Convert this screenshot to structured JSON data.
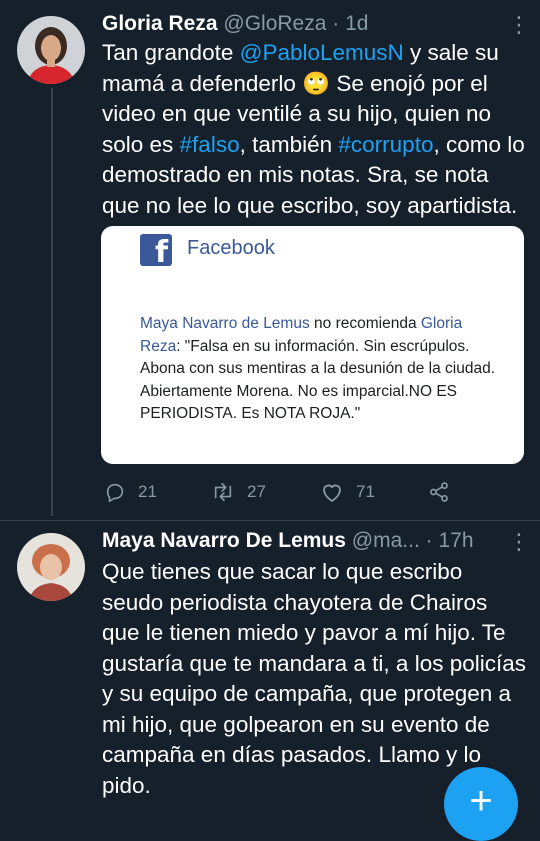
{
  "tweet1": {
    "name": "Gloria Reza",
    "handle": "@GloReza",
    "dot": "·",
    "time": "1d",
    "text": {
      "t1": "Tan grandote ",
      "mention": "@PabloLemusN",
      "t2": " y sale su mamá a defenderlo ",
      "emoji": "🙄",
      "t3": " Se enojó por el video en que ventilé a su hijo, quien no solo es ",
      "hashtag1": "#falso",
      "t4": ", también ",
      "hashtag2": "#corrupto",
      "t5": ", como lo demostrado en mis notas. Sra, se nota que no lee lo que escribo, soy apartidista."
    },
    "card": {
      "logo_letter": "f",
      "title": "Facebook",
      "author": "Maya Navarro de Lemus",
      "verb": " no recomienda ",
      "target": "Gloria Reza",
      "quote": ": \"Falsa en su información. Sin escrúpulos. Abona con sus mentiras a la desunión de la ciudad. Abiertamente Morena. No es imparcial.NO ES PERIODISTA. Es NOTA ROJA.\""
    },
    "actions": {
      "replies": "21",
      "retweets": "27",
      "likes": "71"
    }
  },
  "tweet2": {
    "name": "Maya Navarro De Lemus",
    "handle": "@ma...",
    "dot": "·",
    "time": "17h",
    "text": "Que tienes que sacar lo que escribo seudo periodista chayotera de Chairos que le tienen miedo y pavor a mí hijo. Te gustaría que te mandara a ti, a los policías y su equipo de campaña, que protegen a mi hijo, que golpearon en su evento de campaña en días pasados. Llamo y lo pido."
  },
  "more_icon": "⋮",
  "fab": {
    "label": "+",
    "icon": "compose-plus-icon"
  },
  "colors": {
    "background": "#15202b",
    "accent": "#1da1f2",
    "muted": "#8899a6",
    "facebook": "#3b5998"
  }
}
